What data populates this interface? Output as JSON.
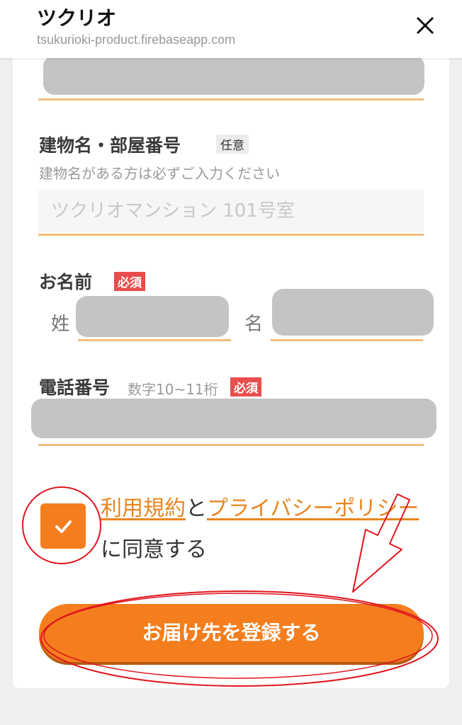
{
  "header": {
    "title": "ツクリオ",
    "url": "tsukurioki-product.firebaseapp.com"
  },
  "form": {
    "building": {
      "label": "建物名・部屋番号",
      "badge": "任意",
      "hint": "建物名がある方は必ずご入力ください",
      "placeholder": "ツクリオマンション 101号室",
      "value": ""
    },
    "name": {
      "label": "お名前",
      "badge": "必須",
      "last_label": "姓",
      "first_label": "名"
    },
    "phone": {
      "label": "電話番号",
      "hint": "数字10~11桁",
      "badge": "必須"
    },
    "agreement": {
      "checked": true,
      "terms_link": "利用規約",
      "connector": "と",
      "privacy_link": "プライバシーポリシー",
      "suffix": "に同意する"
    },
    "submit_label": "お届け先を登録する"
  },
  "colors": {
    "accent": "#f47e1e",
    "underline": "#f4bd7a",
    "required": "#e94d4d",
    "annotation": "#e0141e"
  }
}
